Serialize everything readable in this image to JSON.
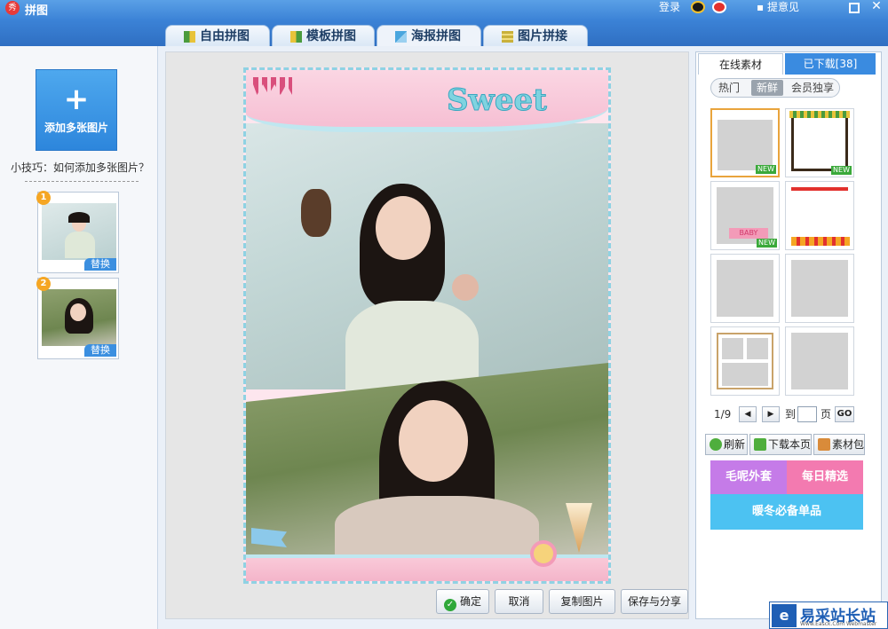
{
  "window": {
    "logo_char": "秀",
    "title": "拼图",
    "login": "登录",
    "feedback": "提意见"
  },
  "tabs": [
    {
      "label": "自由拼图"
    },
    {
      "label": "模板拼图"
    },
    {
      "label": "海报拼图"
    },
    {
      "label": "图片拼接"
    }
  ],
  "active_tab": "海报拼图",
  "left": {
    "add_button_label": "添加多张图片",
    "tip": "小技巧：如何添加多张图片？",
    "thumbnails": [
      {
        "number": "1",
        "replace_label": "替换"
      },
      {
        "number": "2",
        "replace_label": "替换"
      }
    ]
  },
  "poster": {
    "sweet_text": "Sweet"
  },
  "actions": {
    "confirm": "确定",
    "cancel": "取消",
    "copy": "复制图片",
    "save_share": "保存与分享"
  },
  "right": {
    "tab_online": "在线素材",
    "tab_downloaded": "已下载[38]",
    "filters": [
      "热门",
      "新鲜",
      "会员独享"
    ],
    "selected_filter": "新鲜",
    "templates": [
      {
        "new": "NEW"
      },
      {
        "new": "NEW"
      },
      {
        "new": "NEW"
      },
      {
        "new": ""
      },
      {
        "new": ""
      },
      {
        "new": ""
      },
      {
        "new": ""
      },
      {
        "new": ""
      }
    ],
    "pager": {
      "page": "1/9",
      "goto_label": "到",
      "page_unit": "页",
      "go": "GO"
    },
    "buttons": {
      "refresh": "刷新",
      "download_page": "下载本页",
      "material_pack": "素材包"
    },
    "banners": [
      "毛呢外套",
      "每日精选",
      "暖冬必备单品"
    ]
  },
  "watermark": {
    "text": "易采站长站",
    "sub": "Www.Easck.Com Webmaster"
  },
  "colors": {
    "titlebar": "#3b82d6",
    "accent_blue": "#3a8be0",
    "new_badge": "#3aa93a",
    "banner_purple": "#c57be8",
    "banner_pink": "#f37ab0",
    "banner_blue": "#4cc2f2"
  }
}
